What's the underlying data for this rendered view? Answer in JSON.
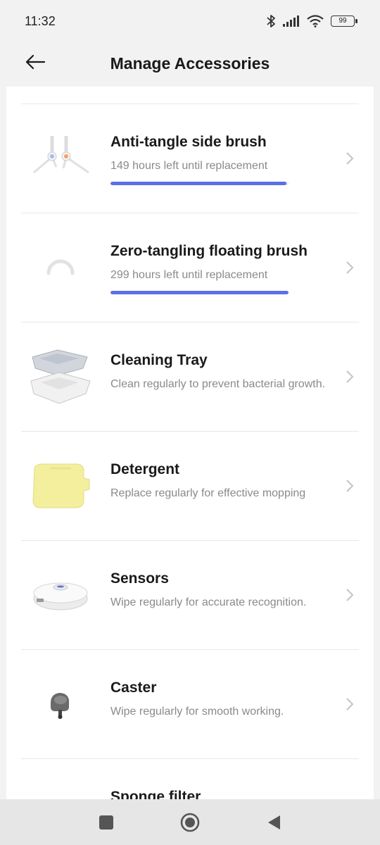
{
  "status_bar": {
    "time": "11:32",
    "battery": "99",
    "icons": [
      "bluetooth-icon",
      "signal-icon",
      "wifi-icon",
      "battery-icon"
    ]
  },
  "header": {
    "title": "Manage Accessories",
    "back_icon": "arrow-left-icon"
  },
  "colors": {
    "accent": "#5b6fe6",
    "background": "#f2f2f2",
    "card": "#ffffff"
  },
  "accessories": [
    {
      "title": "Anti-tangle side brush",
      "subtitle": "149 hours left until replacement",
      "progress": 0.99,
      "icon": "side-brush-image"
    },
    {
      "title": "Zero-tangling floating brush",
      "subtitle": "299 hours left until replacement",
      "progress": 1.0,
      "icon": "loading-spinner-icon"
    },
    {
      "title": "Cleaning Tray",
      "subtitle": "Clean regularly to prevent bacterial growth.",
      "icon": "cleaning-tray-image"
    },
    {
      "title": "Detergent",
      "subtitle": "Replace regularly for effective mopping",
      "icon": "detergent-image"
    },
    {
      "title": "Sensors",
      "subtitle": "Wipe regularly for accurate recognition.",
      "icon": "robot-vacuum-image"
    },
    {
      "title": "Caster",
      "subtitle": "Wipe regularly for smooth working.",
      "icon": "caster-wheel-image"
    },
    {
      "title": "Sponge filter",
      "icon": "sponge-filter-image"
    }
  ],
  "nav_bar": {
    "icons": [
      "recent-apps-icon",
      "home-icon",
      "back-triangle-icon"
    ]
  }
}
